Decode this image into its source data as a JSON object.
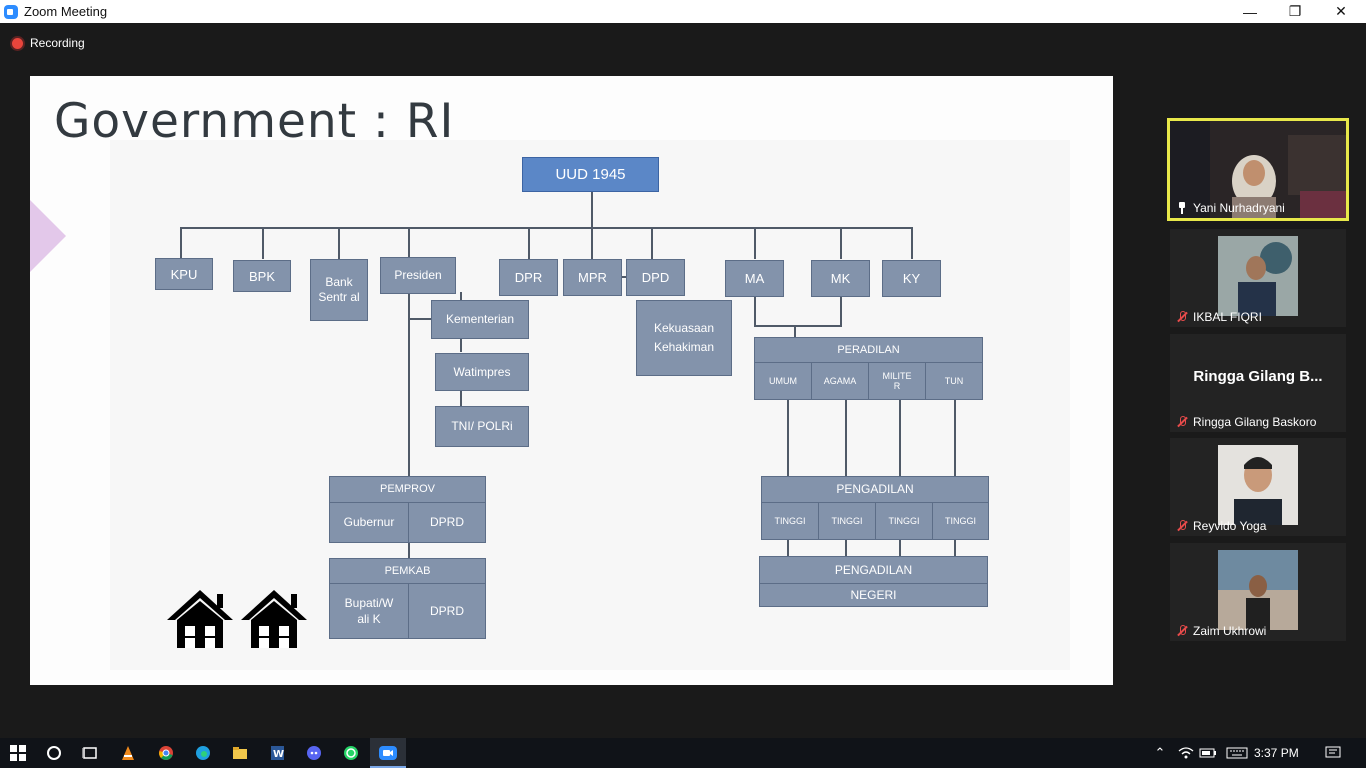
{
  "window": {
    "title": "Zoom Meeting",
    "controls": [
      "minimize",
      "restore",
      "close"
    ]
  },
  "recording": {
    "label": "Recording",
    "color": "#e8453c"
  },
  "slide": {
    "title": "Government : RI",
    "nodes": {
      "uud": "UUD 1945",
      "kpu": "KPU",
      "bpk": "BPK",
      "bank_sentral": "Bank Sentr al",
      "presiden": "Presiden",
      "dpr": "DPR",
      "mpr": "MPR",
      "dpd": "DPD",
      "ma": "MA",
      "mk": "MK",
      "ky": "KY",
      "kementerian": "Kementerian",
      "watimpres": "Watimpres",
      "tni_polri": "TNI/ POLRi",
      "kekuasaan": "Kekuasaan Kehakiman",
      "peradilan": "PERADILAN",
      "peradilan_items": [
        "UMUM",
        "AGAMA",
        "MILITE R",
        "TUN"
      ],
      "pemprov": "PEMPROV",
      "gubernur": "Gubernur",
      "dprd1": "DPRD",
      "pemkab": "PEMKAB",
      "bupati": "Bupati/W ali K",
      "dprd2": "DPRD",
      "pengadilan_tinggi": "PENGADILAN",
      "tinggi_items": [
        "TINGGI",
        "TINGGI",
        "TINGGI",
        "TINGGI"
      ],
      "pengadilan_negeri": "PENGADILAN",
      "negeri": "NEGERI"
    },
    "colors": {
      "node": "#8393ab",
      "root": "#5b87c7"
    },
    "icons": [
      "house-icon",
      "house-icon"
    ]
  },
  "participants": [
    {
      "name": "Yani Nurhadryani",
      "status": "pinned",
      "active": true
    },
    {
      "name": "IKBAL FIQRI",
      "status": "muted"
    },
    {
      "name": "Ringga Gilang Baskoro",
      "display": "Ringga Gilang B...",
      "status": "muted"
    },
    {
      "name": "Reyvido Yoga",
      "status": "muted"
    },
    {
      "name": "Zaim Ukhrowi",
      "status": "muted"
    }
  ],
  "taskbar": {
    "apps": [
      "windows-start",
      "cortana-search",
      "task-view",
      "vlc",
      "chrome",
      "edge",
      "file-explorer",
      "word",
      "discord",
      "whatsapp",
      "zoom"
    ],
    "time": "3:37 PM"
  }
}
